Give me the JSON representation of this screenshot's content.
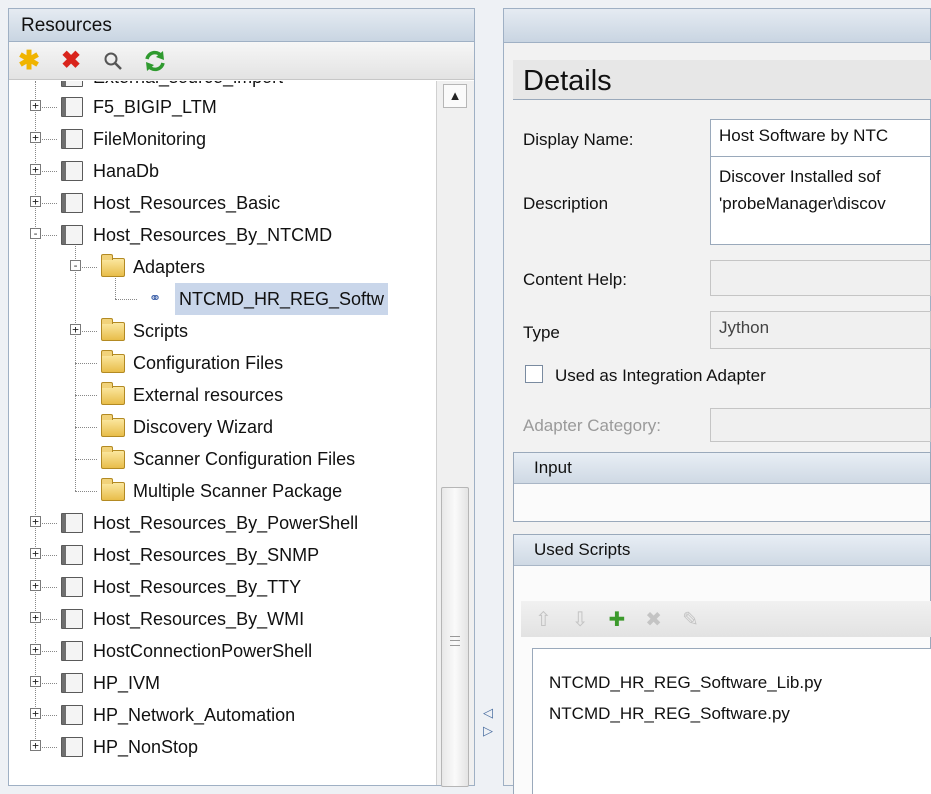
{
  "left_panel": {
    "title": "Resources",
    "toolbar": [
      {
        "name": "new-star-icon",
        "glyph": "✱",
        "color": "#f0b400"
      },
      {
        "name": "delete-x-icon",
        "glyph": "✖",
        "color": "#d9241c"
      },
      {
        "name": "search-icon",
        "glyph": "🔍",
        "color": "#555555"
      },
      {
        "name": "refresh-icon",
        "glyph": "⟳",
        "color": "#2f9a2f"
      }
    ],
    "tree": {
      "partial_top": "External_source_import",
      "items": [
        {
          "label": "F5_BIGIP_LTM"
        },
        {
          "label": "FileMonitoring"
        },
        {
          "label": "HanaDb"
        },
        {
          "label": "Host_Resources_Basic"
        },
        {
          "label": "Host_Resources_By_NTCMD"
        },
        {
          "label": "Adapters"
        },
        {
          "label": "NTCMD_HR_REG_Softw"
        },
        {
          "label": "Scripts"
        },
        {
          "label": "Configuration Files"
        },
        {
          "label": "External resources"
        },
        {
          "label": "Discovery Wizard"
        },
        {
          "label": "Scanner Configuration Files"
        },
        {
          "label": "Multiple Scanner Package"
        },
        {
          "label": "Host_Resources_By_PowerShell"
        },
        {
          "label": "Host_Resources_By_SNMP"
        },
        {
          "label": "Host_Resources_By_TTY"
        },
        {
          "label": "Host_Resources_By_WMI"
        },
        {
          "label": "HostConnectionPowerShell"
        },
        {
          "label": "HP_IVM"
        },
        {
          "label": "HP_Network_Automation"
        },
        {
          "label": "HP_NonStop"
        }
      ]
    }
  },
  "details": {
    "heading": "Details",
    "display_name_label": "Display Name:",
    "display_name_value": "Host Software by NTC",
    "description_label": "Description",
    "description_line1": "Discover Installed sof",
    "description_line2": "'probeManager\\discov",
    "content_help_label": "Content Help:",
    "content_help_value": "",
    "type_label": "Type",
    "type_value": "Jython",
    "integration_checkbox_label": "Used as Integration Adapter",
    "integration_checked": false,
    "adapter_category_label": "Adapter Category:",
    "adapter_category_value": ""
  },
  "input_section": {
    "title": "Input"
  },
  "used_scripts": {
    "title": "Used Scripts",
    "toolbar": [
      {
        "name": "move-up-icon",
        "glyph": "⇧"
      },
      {
        "name": "move-down-icon",
        "glyph": "⇩"
      },
      {
        "name": "add-icon",
        "glyph": "✚"
      },
      {
        "name": "remove-icon",
        "glyph": "✖"
      },
      {
        "name": "edit-pencil-icon",
        "glyph": "✎"
      }
    ],
    "scripts": [
      "NTCMD_HR_REG_Software_Lib.py",
      "NTCMD_HR_REG_Software.py"
    ]
  }
}
